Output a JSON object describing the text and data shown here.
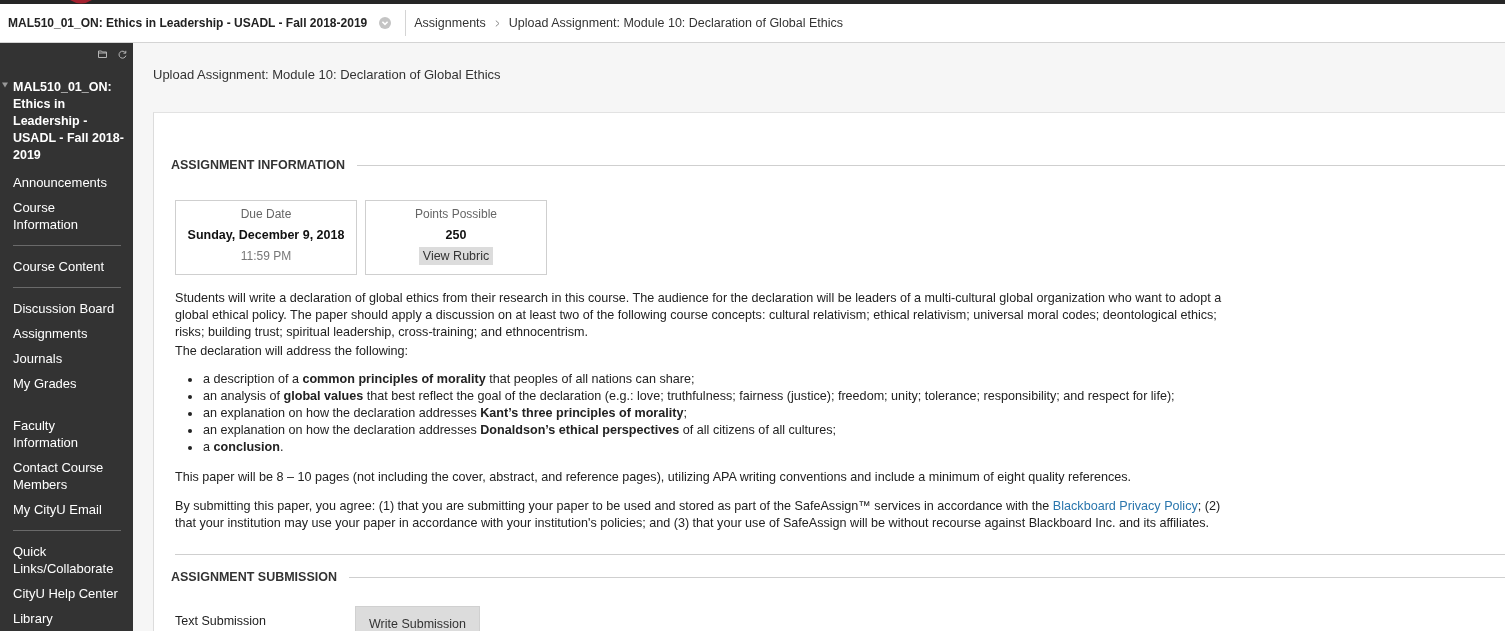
{
  "header": {
    "course_title": "MAL510_01_ON: Ethics in Leadership - USADL - Fall 2018-2019",
    "breadcrumbs": [
      "Assignments",
      "Upload Assignment: Module 10: Declaration of Global Ethics"
    ]
  },
  "sidebar": {
    "course_title": "MAL510_01_ON: Ethics in Leadership - USADL - Fall 2018-2019",
    "expanded": true,
    "sections": [
      {
        "items": [
          "Announcements",
          "Course Information"
        ],
        "divider": true
      },
      {
        "items": [
          "Course Content"
        ],
        "divider": true
      },
      {
        "items": [
          "Discussion Board",
          "Assignments",
          "Journals",
          "My Grades"
        ],
        "divider": false
      },
      {
        "items": [
          "Faculty Information",
          "Contact Course Members",
          "My CityU Email"
        ],
        "divider": true
      },
      {
        "items": [
          "Quick Links/Collaborate",
          "CityU Help Center",
          "Library"
        ],
        "divider": false
      }
    ]
  },
  "page_title": "Upload Assignment: Module 10: Declaration of Global Ethics",
  "assignment_information": {
    "heading": "ASSIGNMENT INFORMATION",
    "due_date": {
      "label": "Due Date",
      "date": "Sunday, December 9, 2018",
      "time": "11:59 PM"
    },
    "points": {
      "label": "Points Possible",
      "value": "250",
      "button": "View Rubric"
    },
    "description": [
      {
        "kind": "paragraph",
        "text": "Students will write a declaration of global ethics from their research in this course. The audience for the declaration will be leaders of a multi-cultural global organization who want to adopt a global ethical policy. The paper should apply a discussion on at least two of the following course concepts: cultural relativism; ethical relativism; universal moral codes; deontological ethics; risks; building trust; spiritual leadership, cross-training; and ethnocentrism."
      },
      {
        "kind": "paragraph",
        "text": "The declaration will address the following:"
      },
      {
        "kind": "list",
        "items": [
          "a description of a **common principles of morality** that peoples of all nations can share;",
          "an analysis of **global values** that best reflect the goal of the declaration (e.g.: love; truthfulness; fairness (justice); freedom; unity; tolerance; responsibility; and respect for life);",
          "an explanation on how the declaration addresses **Kant’s three principles of morality**;",
          "an explanation on how the declaration addresses **Donaldson’s ethical perspectives** of all citizens of all cultures;",
          "a **conclusion**."
        ]
      },
      {
        "kind": "paragraph",
        "text": "This paper will be 8 – 10 pages (not including the cover, abstract, and reference pages), utilizing APA writing conventions and include a minimum of eight quality references."
      },
      {
        "kind": "notice",
        "before": "By submitting this paper, you agree: (1) that you are submitting your paper to be used and stored as part of the SafeAssign™ services in accordance with the ",
        "link": "Blackboard Privacy Policy",
        "after": "; (2) that your institution may use your paper in accordance with your institution's policies; and (3) that your use of SafeAssign will be without recourse against Blackboard Inc. and its affiliates."
      }
    ]
  },
  "assignment_submission": {
    "heading": "ASSIGNMENT SUBMISSION",
    "rows": [
      {
        "label": "Text Submission",
        "button": "Write Submission"
      }
    ]
  }
}
